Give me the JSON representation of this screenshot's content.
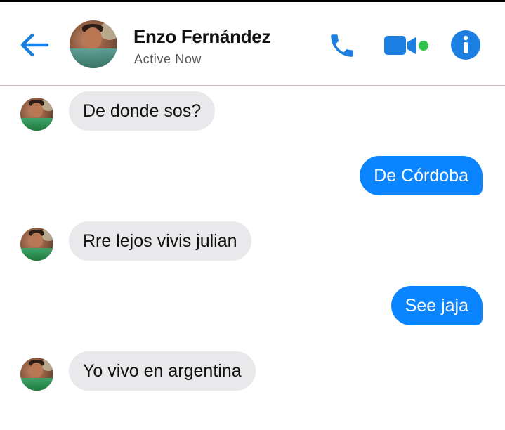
{
  "header": {
    "contact_name": "Enzo Fernández",
    "status": "Active Now",
    "icons": {
      "back": "arrow-left-icon",
      "call": "phone-icon",
      "video": "video-camera-icon",
      "info": "info-icon"
    },
    "accent_color": "#1a7fe0",
    "online_color": "#31c44b"
  },
  "messages": [
    {
      "direction": "incoming",
      "text": "De donde sos?"
    },
    {
      "direction": "outgoing",
      "text": "De Córdoba"
    },
    {
      "direction": "incoming",
      "text": "Rre lejos vivis julian"
    },
    {
      "direction": "outgoing",
      "text": "See jaja"
    },
    {
      "direction": "incoming",
      "text": "Yo vivo en argentina"
    }
  ],
  "colors": {
    "incoming_bubble": "#e9e9eb",
    "outgoing_bubble": "#0a84ff"
  }
}
